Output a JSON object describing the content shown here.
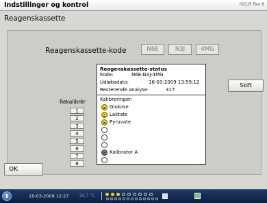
{
  "header": {
    "title": "Indstillinger og kontrol",
    "brand": "ISCUS flex 8"
  },
  "page": {
    "title": "Reagenskassette"
  },
  "cassette": {
    "label": "Reagenskassette-kode",
    "codes": [
      "N6E",
      "N3J",
      "4MG"
    ]
  },
  "status": {
    "title": "Reagenskassette-status",
    "code_label": "Kode:",
    "code_value": "N6E-N3J-4MG",
    "expiry_label": "Udløbsdato:",
    "expiry_value": "16-03-2009 13:59:12",
    "remaining_label": "Resterende analyse:",
    "remaining_value": "317",
    "calibrations_label": "Kalibreringer:",
    "calibrations": [
      {
        "label": "Glukose",
        "state": "yellow",
        "icon": "smiley-icon"
      },
      {
        "label": "Laktate",
        "state": "yellow",
        "icon": "smiley-icon"
      },
      {
        "label": "Pyruvate",
        "state": "yellow",
        "icon": "smiley-icon"
      },
      {
        "label": "",
        "state": "empty",
        "icon": "empty-circle-icon"
      },
      {
        "label": "",
        "state": "empty",
        "icon": "empty-circle-icon"
      },
      {
        "label": "",
        "state": "empty",
        "icon": "empty-circle-icon"
      },
      {
        "label": "Kalibrator A",
        "state": "grey",
        "icon": "calibrator-icon"
      },
      {
        "label": "",
        "state": "empty",
        "icon": "empty-circle-icon"
      },
      {
        "label": "",
        "state": "empty",
        "icon": "empty-circle-icon"
      }
    ]
  },
  "recalibrate": {
    "label": "Rekalibrér",
    "buttons": [
      "1",
      "2",
      "3",
      "4",
      "5",
      "6",
      "7",
      "8"
    ]
  },
  "buttons": {
    "skift": "Skift",
    "ok": "OK"
  },
  "statusbar": {
    "date": "16-03-2009 12:27",
    "temp": "26,7 °C",
    "colors": {
      "bar": "#1f3a66",
      "yellow": "#f2d21a"
    }
  }
}
